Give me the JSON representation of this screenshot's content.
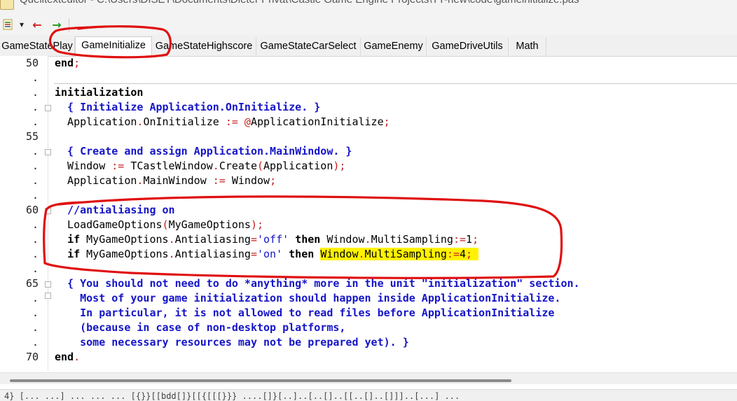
{
  "window": {
    "title": "Quelltexteditor - C:\\Users\\DISET\\Documents\\Dieter Privat\\Castle Game Engine Projects\\TT-new\\code\\gameinitialize.pas"
  },
  "toolbar": {
    "menu_arrow": "▾",
    "back": "←",
    "forward": "→"
  },
  "tabs": [
    {
      "label": "GameStatePlay",
      "active": false
    },
    {
      "label": "GameInitialize",
      "active": true
    },
    {
      "label": "GameStateHighscore",
      "active": false
    },
    {
      "label": "GameStateCarSelect",
      "active": false
    },
    {
      "label": "GameEnemy",
      "active": false
    },
    {
      "label": "GameDriveUtils",
      "active": false
    },
    {
      "label": "Math",
      "active": false
    }
  ],
  "gutter": [
    "50",
    ".",
    ".",
    ".",
    ".",
    "55",
    ".",
    ".",
    ".",
    ".",
    "60",
    ".",
    ".",
    ".",
    ".",
    "65",
    ".",
    ".",
    ".",
    ".",
    "70"
  ],
  "code": [
    {
      "tokens": [
        {
          "t": "end",
          "c": "kw"
        },
        {
          "t": ";",
          "c": "op"
        }
      ]
    },
    {
      "tokens": []
    },
    {
      "tokens": [
        {
          "t": "initialization",
          "c": "kw"
        }
      ]
    },
    {
      "tokens": [
        {
          "t": "  { Initialize Application.OnInitialize. }",
          "c": "cm"
        }
      ]
    },
    {
      "tokens": [
        {
          "t": "  Application",
          "c": "id"
        },
        {
          "t": ".",
          "c": "op"
        },
        {
          "t": "OnInitialize ",
          "c": "id"
        },
        {
          "t": ":= @",
          "c": "op"
        },
        {
          "t": "ApplicationInitialize",
          "c": "id"
        },
        {
          "t": ";",
          "c": "op"
        }
      ]
    },
    {
      "tokens": []
    },
    {
      "tokens": [
        {
          "t": "  { Create and assign Application.MainWindow. }",
          "c": "cm"
        }
      ]
    },
    {
      "tokens": [
        {
          "t": "  Window ",
          "c": "id"
        },
        {
          "t": ":= ",
          "c": "op"
        },
        {
          "t": "TCastleWindow",
          "c": "id"
        },
        {
          "t": ".",
          "c": "op"
        },
        {
          "t": "Create",
          "c": "id"
        },
        {
          "t": "(",
          "c": "op"
        },
        {
          "t": "Application",
          "c": "id"
        },
        {
          "t": ");",
          "c": "op"
        }
      ]
    },
    {
      "tokens": [
        {
          "t": "  Application",
          "c": "id"
        },
        {
          "t": ".",
          "c": "op"
        },
        {
          "t": "MainWindow ",
          "c": "id"
        },
        {
          "t": ":= ",
          "c": "op"
        },
        {
          "t": "Window",
          "c": "id"
        },
        {
          "t": ";",
          "c": "op"
        }
      ]
    },
    {
      "tokens": []
    },
    {
      "tokens": [
        {
          "t": "  //antialiasing on",
          "c": "cm"
        }
      ]
    },
    {
      "tokens": [
        {
          "t": "  LoadGameOptions",
          "c": "id"
        },
        {
          "t": "(",
          "c": "op"
        },
        {
          "t": "MyGameOptions",
          "c": "id"
        },
        {
          "t": ");",
          "c": "op"
        }
      ]
    },
    {
      "tokens": [
        {
          "t": "  ",
          "c": "id"
        },
        {
          "t": "if",
          "c": "kw"
        },
        {
          "t": " MyGameOptions",
          "c": "id"
        },
        {
          "t": ".",
          "c": "op"
        },
        {
          "t": "Antialiasing",
          "c": "id"
        },
        {
          "t": "=",
          "c": "op"
        },
        {
          "t": "'off'",
          "c": "st"
        },
        {
          "t": " ",
          "c": "id"
        },
        {
          "t": "then",
          "c": "kw"
        },
        {
          "t": " Window",
          "c": "id"
        },
        {
          "t": ".",
          "c": "op"
        },
        {
          "t": "MultiSampling",
          "c": "id"
        },
        {
          "t": ":=",
          "c": "op"
        },
        {
          "t": "1",
          "c": "id"
        },
        {
          "t": ";",
          "c": "op"
        }
      ]
    },
    {
      "tokens": [
        {
          "t": "  ",
          "c": "id"
        },
        {
          "t": "if",
          "c": "kw"
        },
        {
          "t": " MyGameOptions",
          "c": "id"
        },
        {
          "t": ".",
          "c": "op"
        },
        {
          "t": "Antialiasing",
          "c": "id"
        },
        {
          "t": "=",
          "c": "op"
        },
        {
          "t": "'on'",
          "c": "st"
        },
        {
          "t": " ",
          "c": "id"
        },
        {
          "t": "then",
          "c": "kw"
        },
        {
          "t": " ",
          "c": "id"
        },
        {
          "t": "Window",
          "c": "id hl"
        },
        {
          "t": ".",
          "c": "op hl"
        },
        {
          "t": "MultiSampling",
          "c": "id hl"
        },
        {
          "t": ":=",
          "c": "op hl"
        },
        {
          "t": "4",
          "c": "id hl"
        },
        {
          "t": ";",
          "c": "op hl"
        },
        {
          "t": " ",
          "c": "id hl"
        }
      ]
    },
    {
      "tokens": []
    },
    {
      "tokens": [
        {
          "t": "  { You should not need to do *anything* more in the unit \"initialization\" section.",
          "c": "cm"
        }
      ]
    },
    {
      "tokens": [
        {
          "t": "    Most of your game initialization should happen inside ApplicationInitialize.",
          "c": "cm"
        }
      ]
    },
    {
      "tokens": [
        {
          "t": "    In particular, it is not allowed to read files before ApplicationInitialize",
          "c": "cm"
        }
      ]
    },
    {
      "tokens": [
        {
          "t": "    (because in case of non-desktop platforms,",
          "c": "cm"
        }
      ]
    },
    {
      "tokens": [
        {
          "t": "    some necessary resources may not be prepared yet). }",
          "c": "cm"
        }
      ]
    },
    {
      "tokens": [
        {
          "t": "end",
          "c": "kw"
        },
        {
          "t": ".",
          "c": "op"
        }
      ]
    }
  ],
  "status": {
    "text": "4}  [... ...]   ...  ...  ...   [{}}[[bdd[]}[[{[[[}}}   ....[]}[..]..[..[]..[[..[]..[]]]..[...] ..."
  },
  "colors": {
    "keyword": "#000000",
    "comment": "#1515c8",
    "symbol": "#c41f1f",
    "highlight": "#fff200",
    "annotation": "#e01010"
  }
}
